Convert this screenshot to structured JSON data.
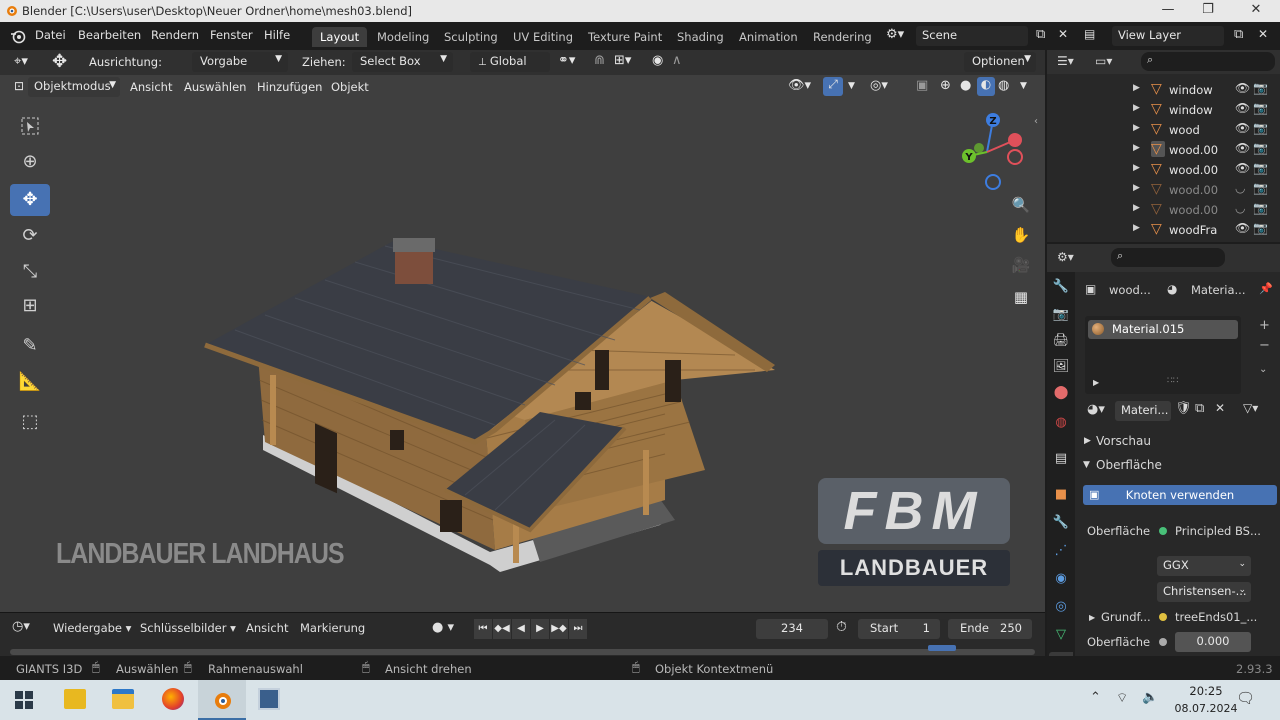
{
  "window": {
    "title": "Blender [C:\\Users\\user\\Desktop\\Neuer Ordner\\home\\mesh03.blend]",
    "controls": [
      "—",
      "❐",
      "✕"
    ]
  },
  "menu": [
    "Datei",
    "Bearbeiten",
    "Rendern",
    "Fenster",
    "Hilfe"
  ],
  "workspaces": [
    "Layout",
    "Modeling",
    "Sculpting",
    "UV Editing",
    "Texture Paint",
    "Shading",
    "Animation",
    "Rendering"
  ],
  "active_workspace": "Layout",
  "scene": "Scene",
  "view_layer": "View Layer",
  "tool_header": {
    "orientation_label": "Ausrichtung:",
    "orientation_value": "Vorgabe",
    "drag_label": "Ziehen:",
    "drag_value": "Select Box",
    "transform_value": "Global",
    "options": "Optionen"
  },
  "viewport_header": {
    "mode": "Objektmodus",
    "menus": [
      "Ansicht",
      "Auswählen",
      "Hinzufügen",
      "Objekt"
    ]
  },
  "gizmo": {
    "z": "Z",
    "y": "Y"
  },
  "watermarks": {
    "left": "LANDBAUER LANDHAUS",
    "logo_top": "FBM",
    "logo_bottom": "LANDBAUER"
  },
  "timeline": {
    "menus": [
      "Wiedergabe",
      "Schlüsselbilder",
      "Ansicht",
      "Markierung"
    ],
    "current_frame": "234",
    "start_label": "Start",
    "start": "1",
    "end_label": "Ende",
    "end": "250"
  },
  "status": {
    "app": "GIANTS I3D",
    "select": "Auswählen",
    "box_select": "Rahmenauswahl",
    "rotate": "Ansicht drehen",
    "context": "Objekt Kontextmenü",
    "version": "2.93.3"
  },
  "outliner": {
    "items": [
      {
        "name": "window",
        "dim": false,
        "visible": true
      },
      {
        "name": "window",
        "dim": false,
        "visible": true
      },
      {
        "name": "wood",
        "dim": false,
        "visible": true
      },
      {
        "name": "wood.00",
        "dim": false,
        "visible": true
      },
      {
        "name": "wood.00",
        "dim": false,
        "visible": true
      },
      {
        "name": "wood.00",
        "dim": true,
        "visible": false
      },
      {
        "name": "wood.00",
        "dim": true,
        "visible": false
      },
      {
        "name": "woodFra",
        "dim": false,
        "visible": true
      }
    ]
  },
  "properties": {
    "breadcrumb_object": "wood...",
    "breadcrumb_material": "Materia...",
    "material_slot": "Material.015",
    "material_field": "Materi...",
    "preview": "Vorschau",
    "surface": "Oberfläche",
    "use_nodes": "Knoten verwenden",
    "surface_label": "Oberfläche",
    "surface_shader": "Principled BS...",
    "distribution": "GGX",
    "subsurface_method": "Christensen-...",
    "base_color_label": "Grundf...",
    "base_color_value": "treeEnds01_...",
    "subsurface_label": "Oberfläche",
    "subsurface_value": "0.000"
  },
  "taskbar": {
    "time": "20:25",
    "date": "08.07.2024"
  }
}
